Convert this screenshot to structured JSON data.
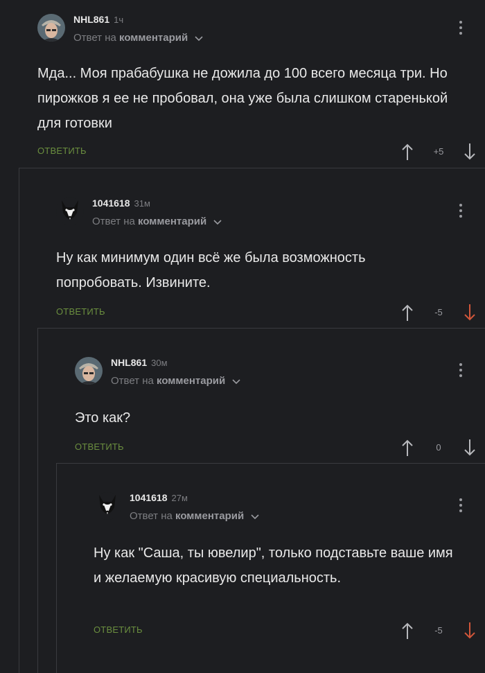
{
  "colors": {
    "background": "#1d1e21",
    "accent_green": "#6b8f3f",
    "downvote_red": "#d1563a",
    "muted": "#7d7e82"
  },
  "comments": [
    {
      "author": "NHL861",
      "time": "1ч",
      "reply_prefix": "Ответ на",
      "reply_target": "комментарий",
      "text": "Мда... Моя прабабушка не дожила до 100 всего месяца три. Но пирожков я ее не пробовал, она уже была слишком старенькой для готовки",
      "reply_label": "ОТВЕТИТЬ",
      "score": "+5",
      "avatar": "old-man-avatar",
      "downvoted": false
    },
    {
      "author": "1041618",
      "time": "31м",
      "reply_prefix": "Ответ на",
      "reply_target": "комментарий",
      "text": "Ну как минимум один всё же была возможность попробовать. Извините.",
      "reply_label": "ОТВЕТИТЬ",
      "score": "-5",
      "avatar": "husky-avatar",
      "downvoted": true
    },
    {
      "author": "NHL861",
      "time": "30м",
      "reply_prefix": "Ответ на",
      "reply_target": "комментарий",
      "text": "Это как?",
      "reply_label": "ОТВЕТИТЬ",
      "score": "0",
      "avatar": "old-man-avatar",
      "downvoted": false
    },
    {
      "author": "1041618",
      "time": "27м",
      "reply_prefix": "Ответ на",
      "reply_target": "комментарий",
      "text": "Ну как \"Саша, ты ювелир\", только подставьте ваше имя и желаемую красивую специальность.",
      "reply_label": "ОТВЕТИТЬ",
      "score": "-5",
      "avatar": "husky-avatar",
      "downvoted": true
    }
  ]
}
